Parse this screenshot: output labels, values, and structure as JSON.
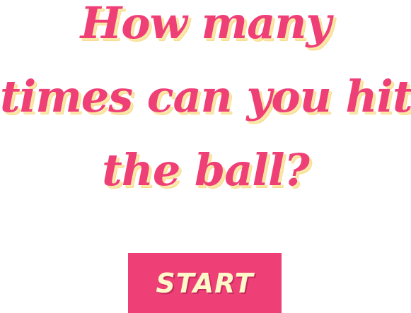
{
  "title": {
    "lines": [
      "How many",
      "times can you hit",
      "the ball?"
    ]
  },
  "start_button": {
    "label": "START"
  },
  "colors": {
    "accent": "#ee3f77",
    "title_shadow": "#fbe7a6",
    "button_text": "#fff8c9",
    "background": "#ffffff"
  }
}
